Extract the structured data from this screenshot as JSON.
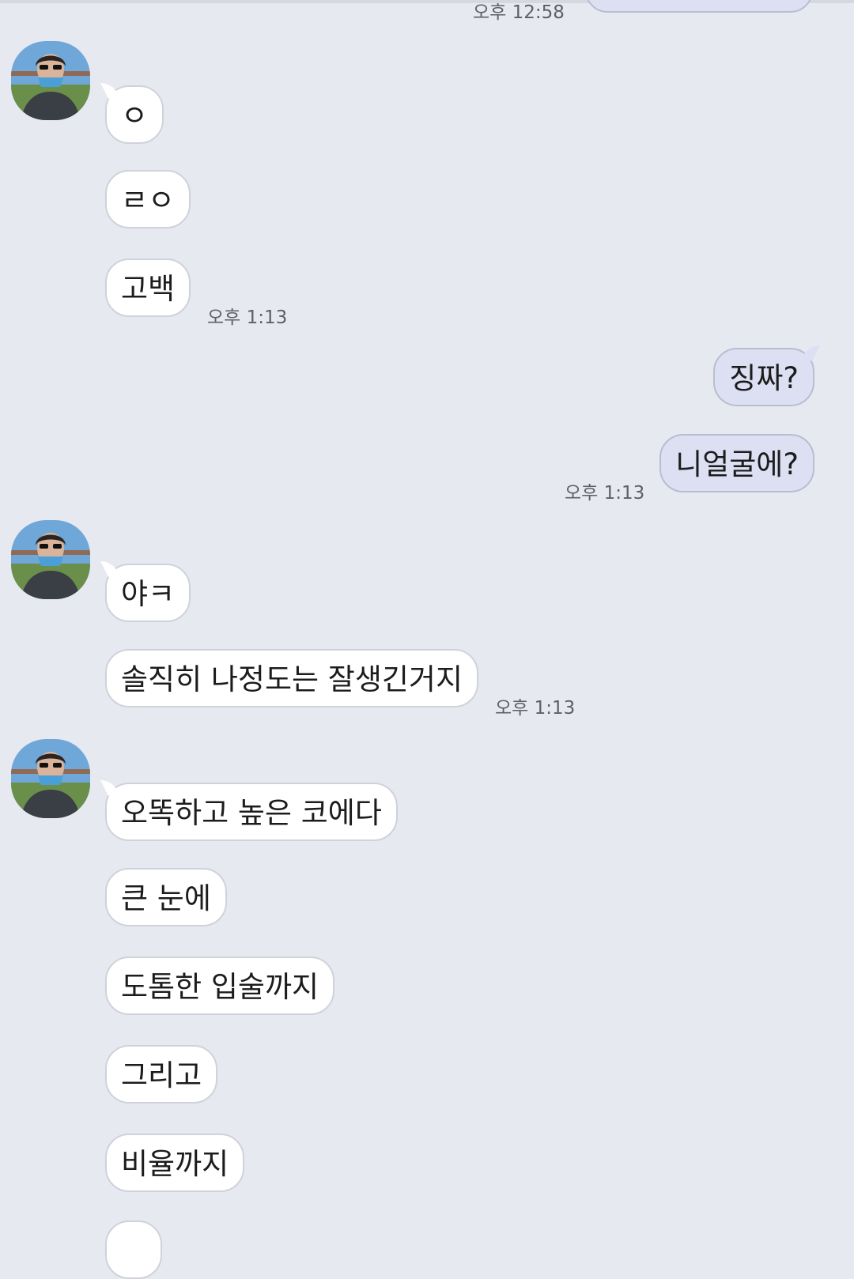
{
  "chat": {
    "avatar_icon": "profile-photo-icon",
    "messages": [
      {
        "side": "out",
        "text": "",
        "time": "오후 12:58"
      },
      {
        "side": "in",
        "text": "ㅇ"
      },
      {
        "side": "in",
        "text": "ㄹㅇ"
      },
      {
        "side": "in",
        "text": "고백",
        "time": "오후 1:13"
      },
      {
        "side": "out",
        "text": "징짜?"
      },
      {
        "side": "out",
        "text": "니얼굴에?",
        "time": "오후 1:13"
      },
      {
        "side": "in",
        "text": "야ㅋ"
      },
      {
        "side": "in",
        "text": "솔직히 나정도는 잘생긴거지",
        "time": "오후 1:13"
      },
      {
        "side": "in",
        "text": "오똑하고 높은 코에다"
      },
      {
        "side": "in",
        "text": "큰 눈에"
      },
      {
        "side": "in",
        "text": "도톰한 입술까지"
      },
      {
        "side": "in",
        "text": "그리고"
      },
      {
        "side": "in",
        "text": "비율까지"
      }
    ]
  },
  "colors": {
    "background": "#e7e9f1",
    "incoming_bubble": "#ffffff",
    "outgoing_bubble": "#dde0f3",
    "timestamp": "#5d6068"
  }
}
